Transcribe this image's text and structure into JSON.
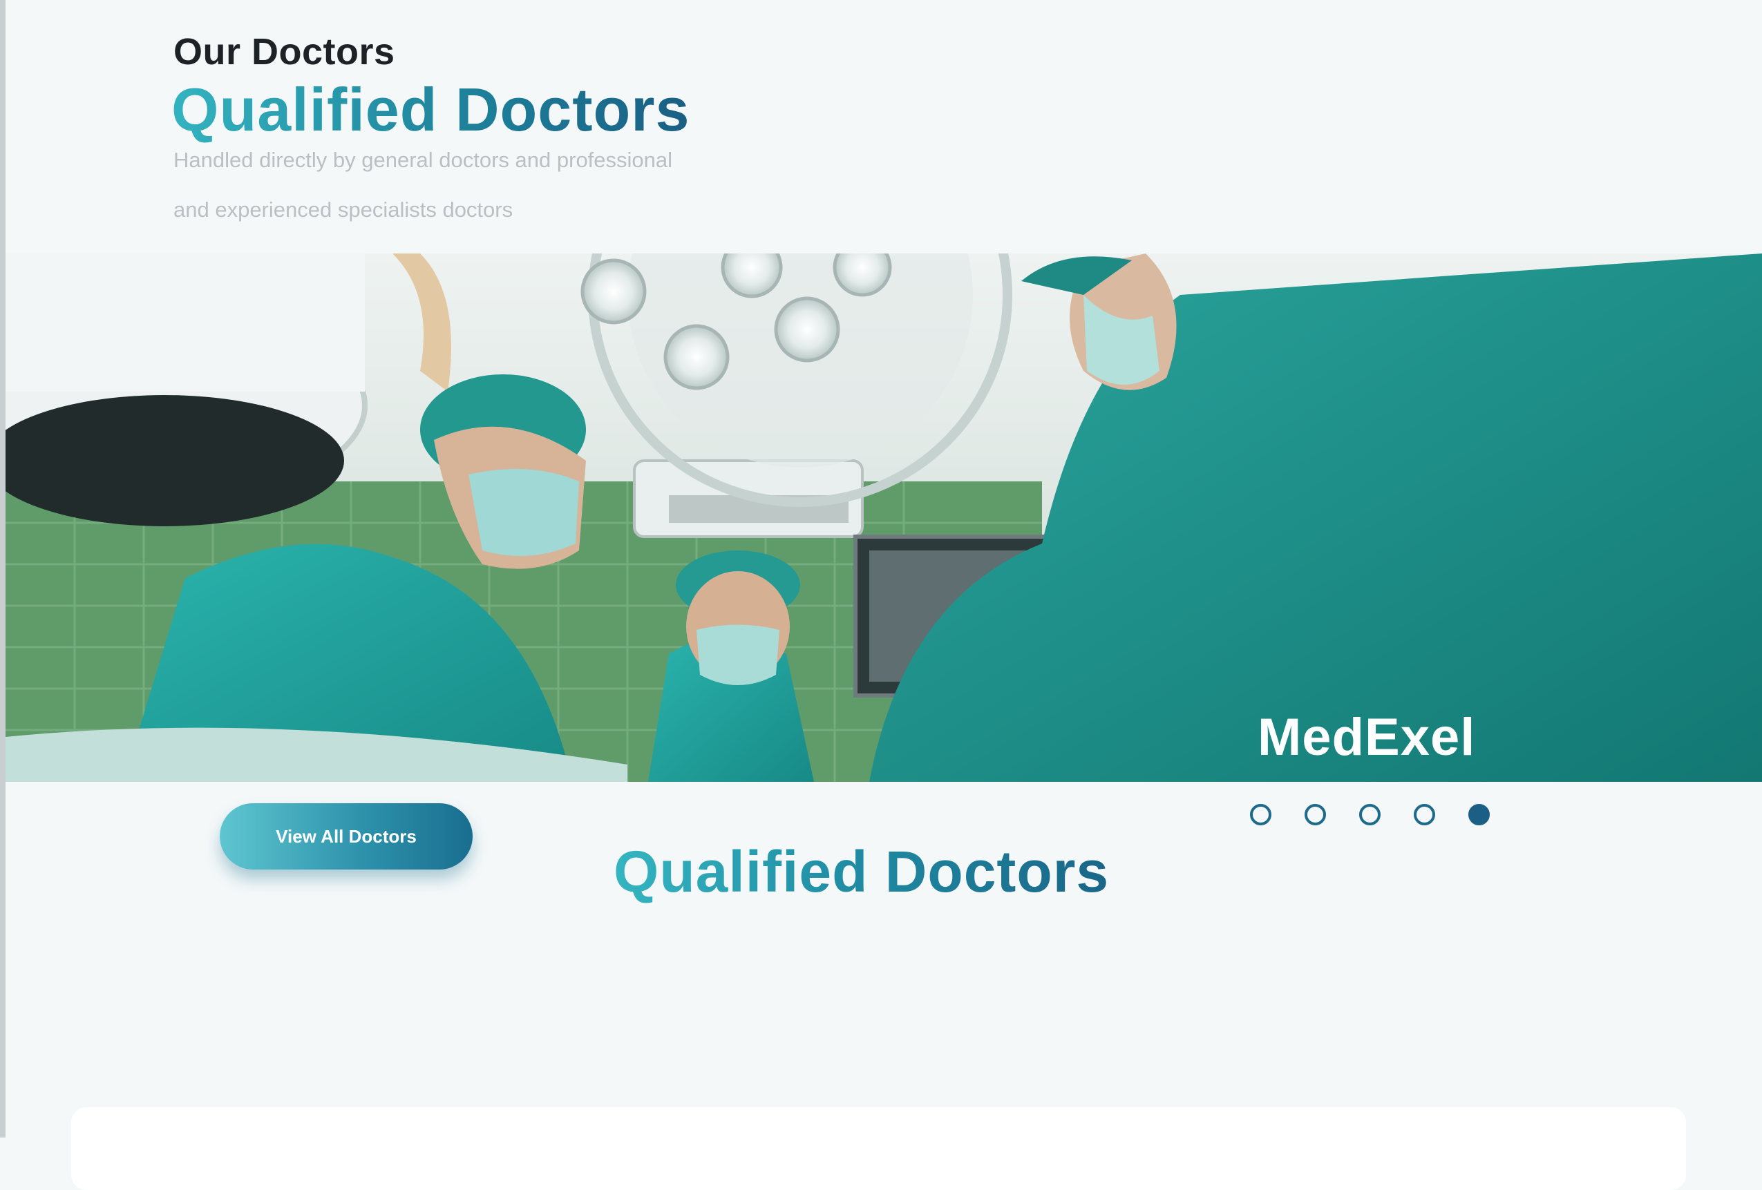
{
  "section": {
    "eyebrow": "Our Doctors",
    "title": "Qualified Doctors",
    "description_line1": "Handled directly by general doctors and professional",
    "description_line2": "and experienced specialists doctors"
  },
  "hero": {
    "brand": "MedExel"
  },
  "cta": {
    "label": "View All Doctors"
  },
  "carousel": {
    "dot_count": 5,
    "active_index": 4
  },
  "subheading": "Qualified Doctors",
  "colors": {
    "accent_teal": "#33b3bf",
    "accent_dark": "#1a5f84",
    "background": "#f4f8f9"
  }
}
